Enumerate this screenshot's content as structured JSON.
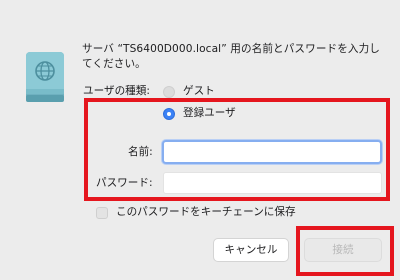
{
  "dialog": {
    "message": "サーバ “TS6400D000.local” 用の名前とパスワードを入力してください。",
    "user_type_label": "ユーザの種類:",
    "user_type_options": [
      {
        "label": "ゲスト",
        "selected": false
      },
      {
        "label": "登録ユーザ",
        "selected": true
      }
    ],
    "name_label": "名前:",
    "name_value": "",
    "password_label": "パスワード:",
    "password_value": "",
    "keychain_label": "このパスワードをキーチェーンに保存",
    "keychain_checked": false,
    "cancel_button": "キャンセル",
    "connect_button": "接続"
  },
  "icons": {
    "server": "network-server-icon"
  },
  "colors": {
    "accent": "#3b82f6",
    "highlight": "#e5161e",
    "background": "#ececec"
  }
}
